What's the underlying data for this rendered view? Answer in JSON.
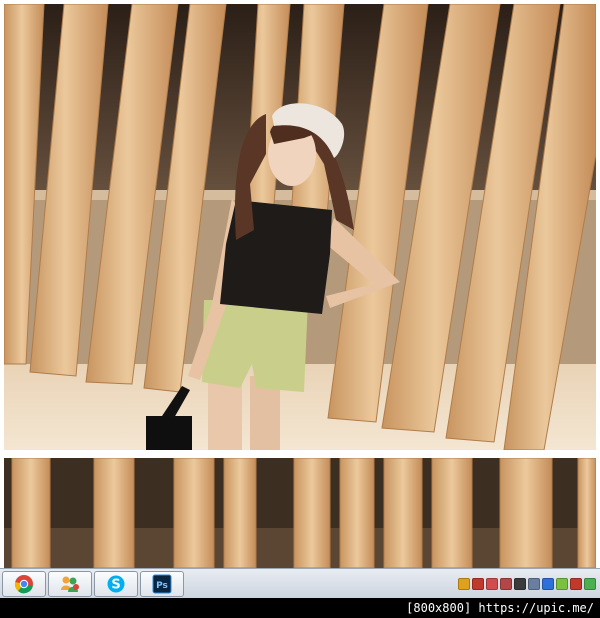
{
  "watermark": {
    "size_label": "[800x800]",
    "url": "https://upic.me/"
  },
  "taskbar": {
    "buttons": [
      {
        "name": "chrome",
        "icon": "chrome-icon"
      },
      {
        "name": "messenger",
        "icon": "messenger-people-icon"
      },
      {
        "name": "skype",
        "icon": "skype-icon"
      },
      {
        "name": "photoshop",
        "icon": "photoshop-icon",
        "label": "Ps"
      }
    ],
    "tray_icons": [
      {
        "icon": "lightbulb-icon",
        "color": "#e0a21c"
      },
      {
        "icon": "shield-icon",
        "color": "#c0392b"
      },
      {
        "icon": "pin-icon",
        "color": "#d14d4d"
      },
      {
        "icon": "monitor-icon",
        "color": "#b34747"
      },
      {
        "icon": "steam-icon",
        "color": "#3b3b3b"
      },
      {
        "icon": "network-icon",
        "color": "#6a7fa0"
      },
      {
        "icon": "bolt-icon",
        "color": "#2f6fd8"
      },
      {
        "icon": "speech-icon",
        "color": "#7ac142"
      },
      {
        "icon": "flask-icon",
        "color": "#c0392b"
      },
      {
        "icon": "battery-icon",
        "color": "#4caf50"
      }
    ]
  },
  "colors": {
    "wood": "#d8ab7a",
    "wood_light": "#ebc89b",
    "background_dark": "#3a2a1d",
    "shorts": "#c9cf8a",
    "top": "#1e1b19"
  }
}
